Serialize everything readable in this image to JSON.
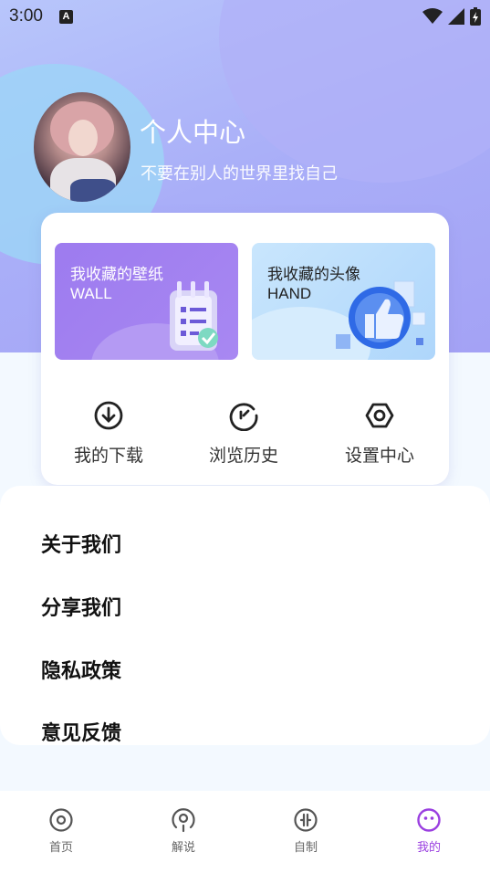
{
  "status_bar": {
    "time": "3:00",
    "badge": "A"
  },
  "profile": {
    "title": "个人中心",
    "subtitle": "不要在别人的世界里找自己"
  },
  "collections": [
    {
      "title": "我收藏的壁纸",
      "subtitle": "WALL"
    },
    {
      "title": "我收藏的头像",
      "subtitle": "HAND"
    }
  ],
  "quick_actions": [
    {
      "label": "我的下载",
      "icon": "download-icon"
    },
    {
      "label": "浏览历史",
      "icon": "history-icon"
    },
    {
      "label": "设置中心",
      "icon": "settings-icon"
    }
  ],
  "menu": [
    {
      "label": "关于我们"
    },
    {
      "label": "分享我们"
    },
    {
      "label": "隐私政策"
    },
    {
      "label": "意见反馈"
    }
  ],
  "tabs": [
    {
      "label": "首页",
      "icon": "home-icon",
      "active": false
    },
    {
      "label": "解说",
      "icon": "explain-icon",
      "active": false
    },
    {
      "label": "自制",
      "icon": "custom-icon",
      "active": false
    },
    {
      "label": "我的",
      "icon": "profile-icon",
      "active": true
    }
  ],
  "colors": {
    "accent": "#9a3fe0",
    "hero_gradient": [
      "#b8c6fb",
      "#a4a2f5"
    ],
    "wall_tile": "#9d7bef",
    "hand_tile": "#c9e6fd"
  }
}
